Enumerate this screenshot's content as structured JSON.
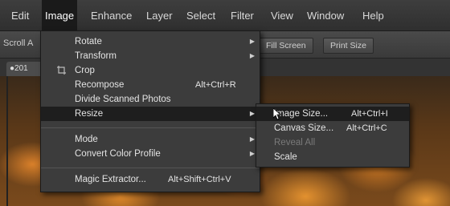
{
  "menubar": {
    "items": [
      "Edit",
      "Image",
      "Enhance",
      "Layer",
      "Select",
      "Filter",
      "View",
      "Window",
      "Help"
    ]
  },
  "toolbar": {
    "left_text": "Scroll A",
    "fill_screen": "Fill Screen",
    "print_size": "Print Size"
  },
  "tab": {
    "label": "●201"
  },
  "image_menu": {
    "rotate": "Rotate",
    "transform": "Transform",
    "crop": "Crop",
    "recompose": "Recompose",
    "recompose_shortcut": "Alt+Ctrl+R",
    "divide": "Divide Scanned Photos",
    "resize": "Resize",
    "mode": "Mode",
    "convert_profile": "Convert Color Profile",
    "magic_extractor": "Magic Extractor...",
    "magic_extractor_shortcut": "Alt+Shift+Ctrl+V"
  },
  "resize_menu": {
    "image_size": "Image Size...",
    "image_size_shortcut": "Alt+Ctrl+I",
    "canvas_size": "Canvas Size...",
    "canvas_size_shortcut": "Alt+Ctrl+C",
    "reveal_all": "Reveal All",
    "scale": "Scale"
  }
}
